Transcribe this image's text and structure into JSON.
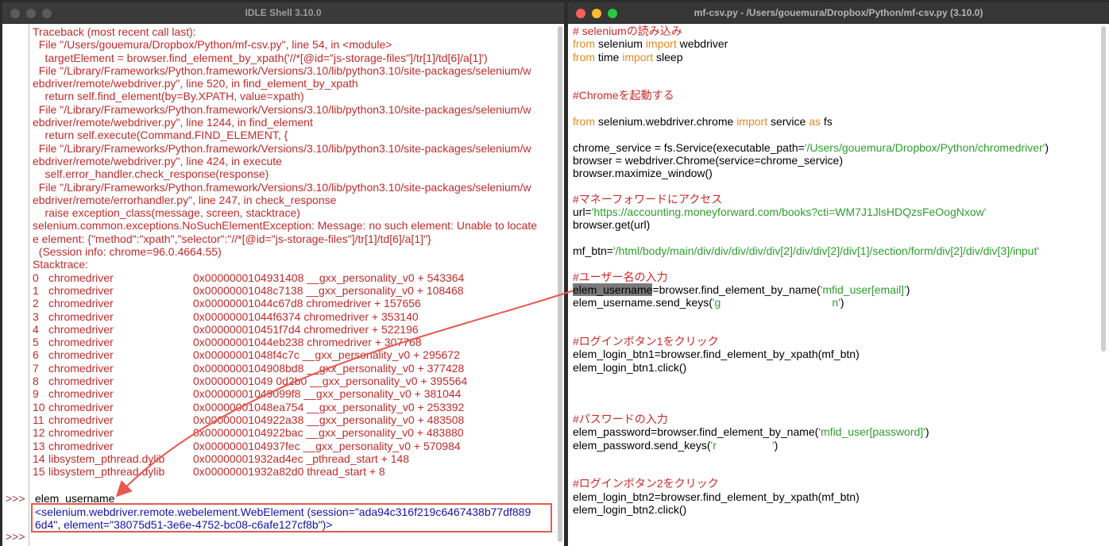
{
  "idle": {
    "title": "IDLE Shell 3.10.0",
    "traceback": [
      "Traceback (most recent call last):",
      "  File \"/Users/gouemura/Dropbox/Python/mf-csv.py\", line 54, in <module>",
      "    targetElement = browser.find_element_by_xpath('//*[@id=\"js-storage-files\"]/tr[1]/td[6]/a[1]')",
      "  File \"/Library/Frameworks/Python.framework/Versions/3.10/lib/python3.10/site-packages/selenium/w",
      "ebdriver/remote/webdriver.py\", line 520, in find_element_by_xpath",
      "    return self.find_element(by=By.XPATH, value=xpath)",
      "  File \"/Library/Frameworks/Python.framework/Versions/3.10/lib/python3.10/site-packages/selenium/w",
      "ebdriver/remote/webdriver.py\", line 1244, in find_element",
      "    return self.execute(Command.FIND_ELEMENT, {",
      "  File \"/Library/Frameworks/Python.framework/Versions/3.10/lib/python3.10/site-packages/selenium/w",
      "ebdriver/remote/webdriver.py\", line 424, in execute",
      "    self.error_handler.check_response(response)",
      "  File \"/Library/Frameworks/Python.framework/Versions/3.10/lib/python3.10/site-packages/selenium/w",
      "ebdriver/remote/errorhandler.py\", line 247, in check_response",
      "    raise exception_class(message, screen, stacktrace)",
      "selenium.common.exceptions.NoSuchElementException: Message: no such element: Unable to locate",
      "e element: {\"method\":\"xpath\",\"selector\":\"//*[@id=\"js-storage-files\"]/tr[1]/td[6]/a[1]\"}",
      "  (Session info: chrome=96.0.4664.55)",
      "Stacktrace:"
    ],
    "stacktrace": [
      {
        "num": "0",
        "name": "chromedriver",
        "addr": "0x0000000104931408 __gxx_personality_v0 + 543364"
      },
      {
        "num": "1",
        "name": "chromedriver",
        "addr": "0x00000001048c7138 __gxx_personality_v0 + 108468"
      },
      {
        "num": "2",
        "name": "chromedriver",
        "addr": "0x00000001044c67d8 chromedriver + 157656"
      },
      {
        "num": "3",
        "name": "chromedriver",
        "addr": "0x00000001044f6374 chromedriver + 353140"
      },
      {
        "num": "4",
        "name": "chromedriver",
        "addr": "0x000000010451f7d4 chromedriver + 522196"
      },
      {
        "num": "5",
        "name": "chromedriver",
        "addr": "0x00000001044eb238 chromedriver + 307768"
      },
      {
        "num": "6",
        "name": "chromedriver",
        "addr": "0x00000001048f4c7c __gxx_personality_v0 + 295672"
      },
      {
        "num": "7",
        "name": "chromedriver",
        "addr": "0x0000000104908bd8 __gxx_personality_v0 + 377428"
      },
      {
        "num": "8",
        "name": "chromedriver",
        "addr": "0x00000001049 0d2b0 __gxx_personality_v0 + 395564"
      },
      {
        "num": "9",
        "name": "chromedriver",
        "addr": "0x00000001049099f8 __gxx_personality_v0 + 381044"
      },
      {
        "num": "10",
        "name": "chromedriver",
        "addr": "0x00000001048ea754 __gxx_personality_v0 + 253392"
      },
      {
        "num": "11",
        "name": "chromedriver",
        "addr": "0x0000000104922a38 __gxx_personality_v0 + 483508"
      },
      {
        "num": "12",
        "name": "chromedriver",
        "addr": "0x0000000104922bac __gxx_personality_v0 + 483880"
      },
      {
        "num": "13",
        "name": "chromedriver",
        "addr": "0x0000000104937fec __gxx_personality_v0 + 570984"
      },
      {
        "num": "14",
        "name": "libsystem_pthread.dylib",
        "addr": "0x00000001932ad4ec _pthread_start + 148"
      },
      {
        "num": "15",
        "name": "libsystem_pthread.dylib",
        "addr": "0x00000001932a82d0 thread_start + 8"
      }
    ],
    "prompt": ">>>",
    "input_command": "elem_username",
    "result_line1": "<selenium.webdriver.remote.webelement.WebElement (session=\"ada94c316f219c6467438b77df889",
    "result_line2": "6d4\", element=\"38075d51-3e6e-4752-bc08-c6afe127cf8b\")>"
  },
  "editor": {
    "title": "mf-csv.py - /Users/gouemura/Dropbox/Python/mf-csv.py (3.10.0)",
    "lines": [
      [
        {
          "t": "# seleniumの読み込み",
          "c": "comment"
        }
      ],
      [
        {
          "t": "from",
          "c": "kw"
        },
        {
          "t": " selenium "
        },
        {
          "t": "import",
          "c": "kw"
        },
        {
          "t": " webdriver"
        }
      ],
      [
        {
          "t": "from",
          "c": "kw"
        },
        {
          "t": " time "
        },
        {
          "t": "import",
          "c": "kw"
        },
        {
          "t": " sleep"
        }
      ],
      [],
      [],
      [
        {
          "t": "#Chromeを起動する",
          "c": "comment"
        }
      ],
      [],
      [
        {
          "t": "from",
          "c": "kw"
        },
        {
          "t": " selenium.webdriver.chrome "
        },
        {
          "t": "import",
          "c": "kw"
        },
        {
          "t": " service "
        },
        {
          "t": "as",
          "c": "kw"
        },
        {
          "t": " fs"
        }
      ],
      [],
      [
        {
          "t": "chrome_service = fs.Service(executable_path="
        },
        {
          "t": "'/Users/gouemura/Dropbox/Python/chromedriver'",
          "c": "str"
        },
        {
          "t": ")"
        }
      ],
      [
        {
          "t": "browser = webdriver.Chrome(service=chrome_service)"
        }
      ],
      [
        {
          "t": "browser.maximize_window()"
        }
      ],
      [],
      [
        {
          "t": "#マネーフォワードにアクセス",
          "c": "comment"
        }
      ],
      [
        {
          "t": "url="
        },
        {
          "t": "'https://accounting.moneyforward.com/books?cti=WM7J1JlsHDQzsFeOogNxow'",
          "c": "str"
        }
      ],
      [
        {
          "t": "browser.get(url)"
        }
      ],
      [],
      [
        {
          "t": "mf_btn="
        },
        {
          "t": "'/html/body/main/div/div/div/div/div[2]/div/div[2]/div[1]/section/form/div[2]/div/div[3]/input'",
          "c": "str"
        }
      ],
      [],
      [
        {
          "t": "#ユーザー名の入力",
          "c": "comment"
        }
      ],
      [
        {
          "t": "elem_username",
          "c": "hl"
        },
        {
          "t": "=browser.find_element_by_name("
        },
        {
          "t": "'mfid_user[email]'",
          "c": "str"
        },
        {
          "t": ")"
        }
      ],
      [
        {
          "t": "elem_username.send_keys("
        },
        {
          "t": "'g                                    n'",
          "c": "str"
        },
        {
          "t": ")"
        }
      ],
      [],
      [],
      [
        {
          "t": "#ログインボタン1をクリック",
          "c": "comment"
        }
      ],
      [
        {
          "t": "elem_login_btn1=browser.find_element_by_xpath(mf_btn)"
        }
      ],
      [
        {
          "t": "elem_login_btn1.click()"
        }
      ],
      [],
      [],
      [],
      [
        {
          "t": "#パスワードの入力",
          "c": "comment"
        }
      ],
      [
        {
          "t": "elem_password=browser.find_element_by_name("
        },
        {
          "t": "'mfid_user[password]'",
          "c": "str"
        },
        {
          "t": ")"
        }
      ],
      [
        {
          "t": "elem_password.send_keys("
        },
        {
          "t": "'r                  '",
          "c": "str"
        },
        {
          "t": ")"
        }
      ],
      [],
      [],
      [
        {
          "t": "#ログインボタン2をクリック",
          "c": "comment"
        }
      ],
      [
        {
          "t": "elem_login_btn2=browser.find_element_by_xpath(mf_btn)"
        }
      ],
      [
        {
          "t": "elem_login_btn2.click()"
        }
      ]
    ]
  },
  "colors": {
    "error_text": "#c02b2b",
    "result_text": "#1414a8",
    "annotation": "#e8584f",
    "keyword": "#e8891e",
    "string": "#2e9e2e",
    "comment": "#cc2a2a"
  }
}
